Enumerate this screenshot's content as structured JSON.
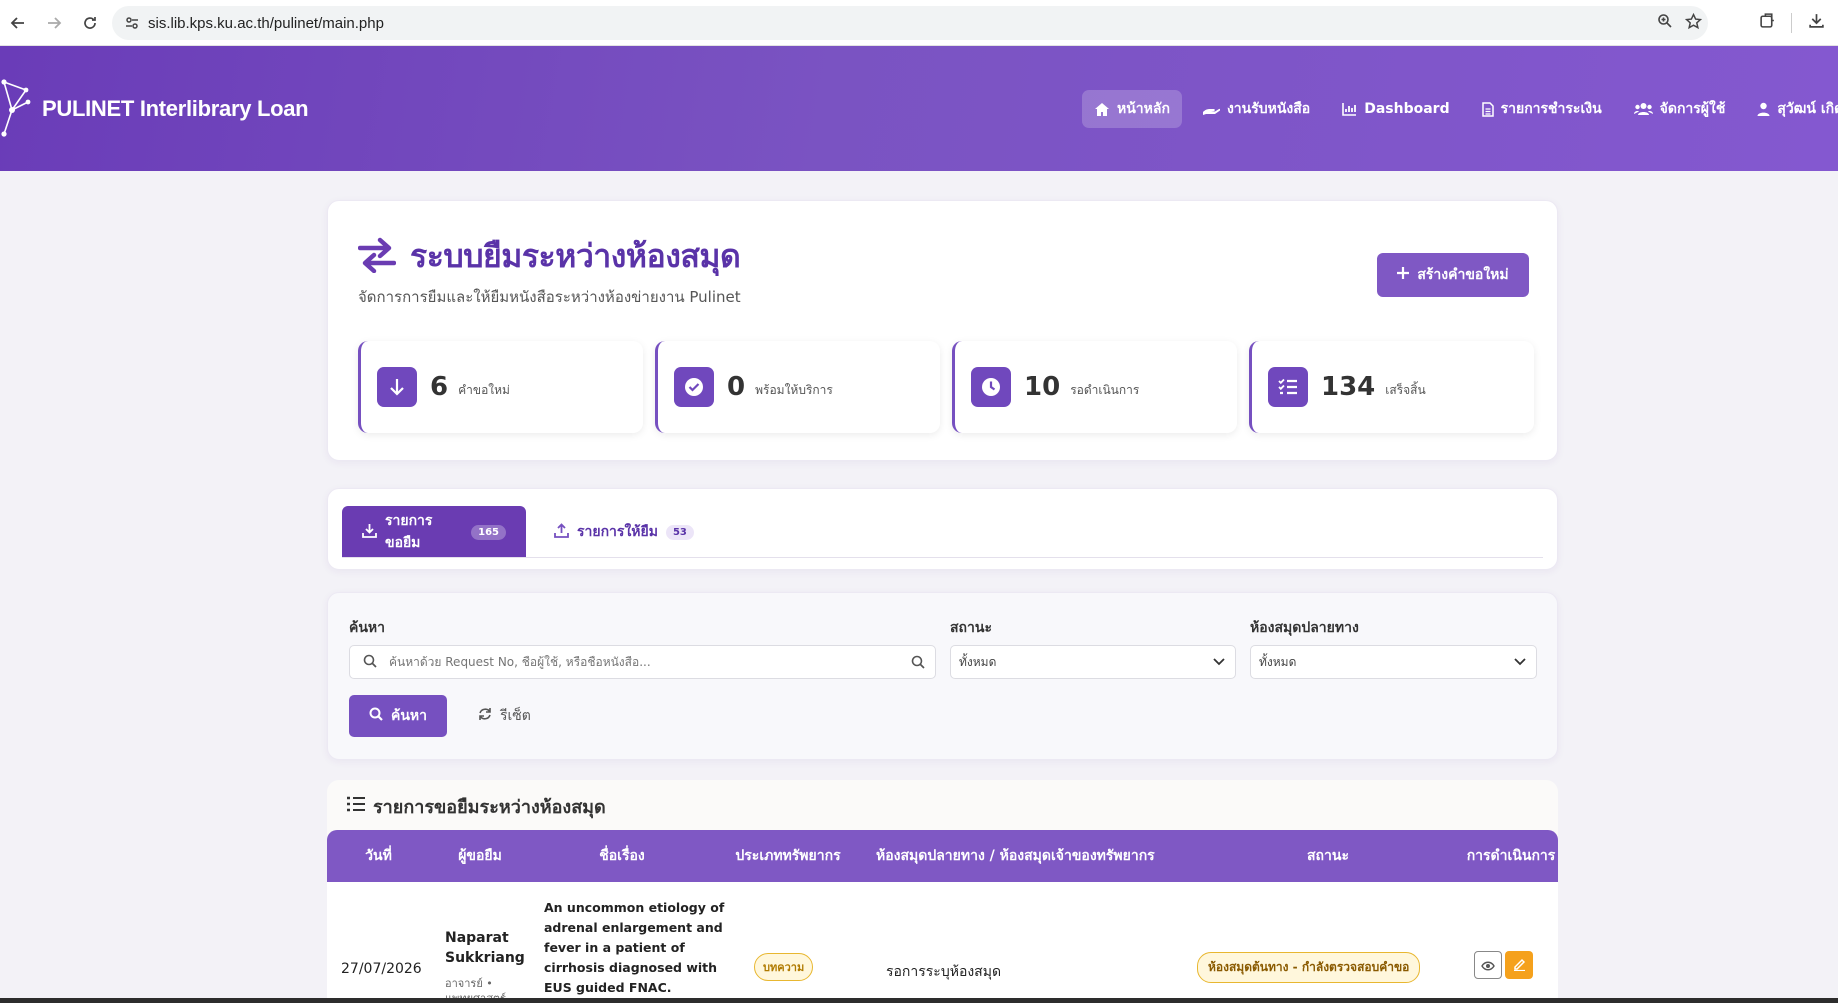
{
  "browser": {
    "url": "sis.lib.kps.ku.ac.th/pulinet/main.php"
  },
  "header": {
    "brand": "PULINET Interlibrary Loan",
    "nav": [
      {
        "label": "หน้าหลัก",
        "icon": "home-icon",
        "active": true
      },
      {
        "label": "งานรับหนังสือ",
        "icon": "hand-icon",
        "active": false
      },
      {
        "label": "Dashboard",
        "icon": "chart-icon",
        "active": false
      },
      {
        "label": "รายการชำระเงิน",
        "icon": "document-icon",
        "active": false
      },
      {
        "label": "จัดการผู้ใช้",
        "icon": "users-icon",
        "active": false
      },
      {
        "label": "สุวัฒน์ เกิดม",
        "icon": "user-icon",
        "active": false
      }
    ]
  },
  "page": {
    "title": "ระบบยืมระหว่างห้องสมุด",
    "subtitle": "จัดการการยืมและให้ยืมหนังสือระหว่างห้องข่ายงาน Pulinet",
    "create_button": "สร้างคำขอใหม่",
    "stats": [
      {
        "value": "6",
        "label": "คำขอใหม่",
        "icon": "arrow-down-icon"
      },
      {
        "value": "0",
        "label": "พร้อมให้บริการ",
        "icon": "check-circle-icon"
      },
      {
        "value": "10",
        "label": "รอดำเนินการ",
        "icon": "clock-icon"
      },
      {
        "value": "134",
        "label": "เสร็จสิ้น",
        "icon": "list-check-icon"
      }
    ]
  },
  "tabs": [
    {
      "label": "รายการขอยืม",
      "count": "165",
      "icon": "download-icon",
      "active": true
    },
    {
      "label": "รายการให้ยืม",
      "count": "53",
      "icon": "upload-icon",
      "active": false
    }
  ],
  "filters": {
    "search_label": "ค้นหา",
    "search_placeholder": "ค้นหาด้วย Request No, ชื่อผู้ใช้, หรือชื่อหนังสือ...",
    "status_label": "สถานะ",
    "status_value": "ทั้งหมด",
    "library_label": "ห้องสมุดปลายทาง",
    "library_value": "ทั้งหมด",
    "search_button": "ค้นหา",
    "reset_button": "รีเซ็ต"
  },
  "list": {
    "title": "รายการขอยืมระหว่างห้องสมุด",
    "columns": [
      "วันที่",
      "ผู้ขอยืม",
      "ชื่อเรื่อง",
      "ประเภททรัพยากร",
      "ห้องสมุดปลายทาง / ห้องสมุดเจ้าของทรัพยากร",
      "สถานะ",
      "การดำเนินการ"
    ],
    "rows": [
      {
        "date": "27/07/2026",
        "borrower_name_1": "Naparat",
        "borrower_name_2": "Sukkriang",
        "borrower_role_1": "อาจารย์ •",
        "borrower_role_2": "แพทยศาสตร์",
        "title_lines": [
          "An uncommon etiology of",
          "adrenal enlargement and",
          "fever in a patient of",
          "cirrhosis diagnosed with",
          "EUS guided FNAC."
        ],
        "type": "บทความ",
        "library": "รอการระบุห้องสมุด",
        "status": "ห้องสมุดต้นทาง - กำลังตรวจสอบคำขอ"
      }
    ]
  },
  "colors": {
    "primary": "#7650c0",
    "header_gradient_start": "#6a3cb8",
    "header_gradient_end": "#8458d0",
    "status_pill_bg": "#fff7dc",
    "status_pill_border": "#e8b730",
    "edit_button": "#f5a11c"
  }
}
